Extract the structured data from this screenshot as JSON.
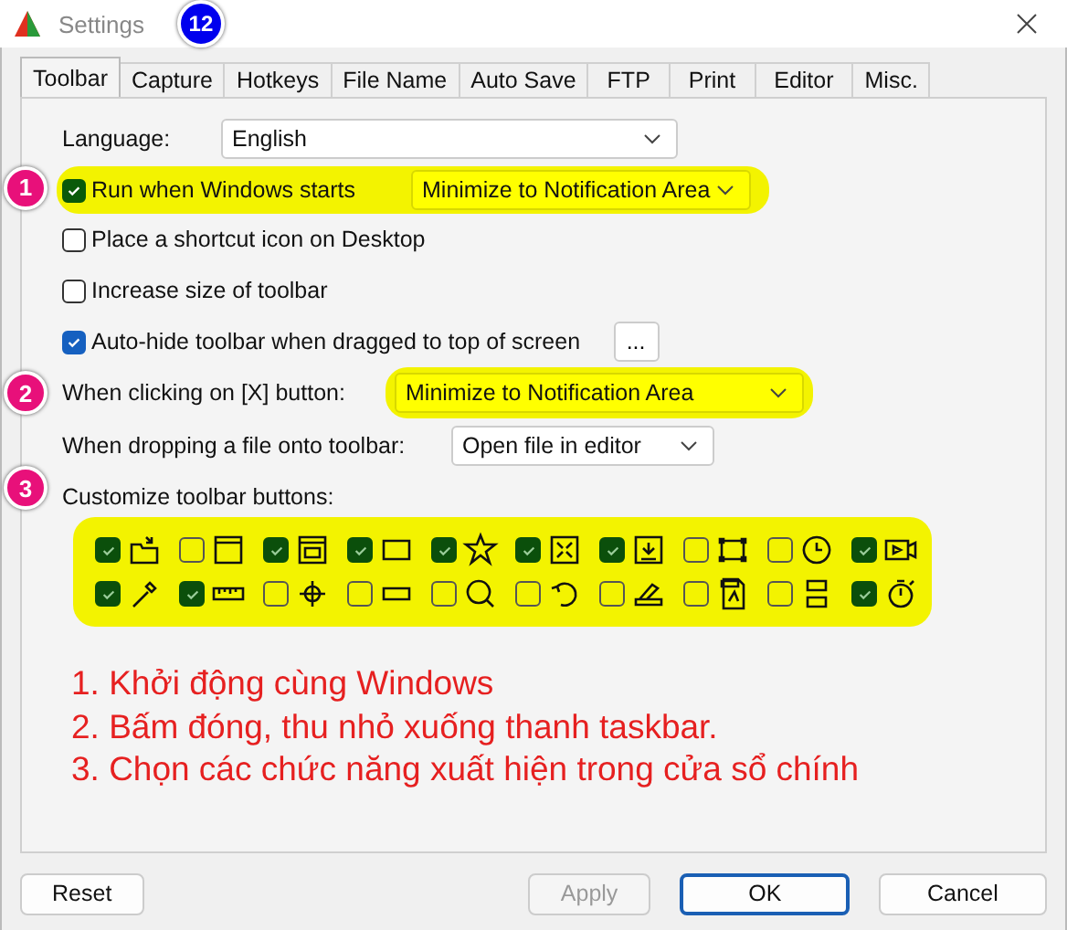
{
  "window": {
    "title": "Settings",
    "badge": "12"
  },
  "tabs": [
    {
      "label": "Toolbar",
      "selected": true
    },
    {
      "label": "Capture",
      "selected": false
    },
    {
      "label": "Hotkeys",
      "selected": false
    },
    {
      "label": "File Name",
      "selected": false
    },
    {
      "label": "Auto Save",
      "selected": false
    },
    {
      "label": "FTP",
      "selected": false
    },
    {
      "label": "Print",
      "selected": false
    },
    {
      "label": "Editor",
      "selected": false
    },
    {
      "label": "Misc.",
      "selected": false
    }
  ],
  "language": {
    "label": "Language:",
    "value": "English"
  },
  "run_at_start": {
    "marker": "1",
    "label": "Run when Windows starts",
    "checked": true,
    "mode": "Minimize to Notification Area",
    "highlighted": true
  },
  "options": [
    {
      "label": "Place a shortcut icon on Desktop",
      "checked": false
    },
    {
      "label": "Increase size of toolbar",
      "checked": false
    },
    {
      "label": "Auto-hide toolbar when dragged to top of screen",
      "checked": true,
      "more_button": "..."
    }
  ],
  "close_action": {
    "marker": "2",
    "label": "When clicking on [X] button:",
    "value": "Minimize to Notification Area",
    "highlighted": true
  },
  "drop_action": {
    "label": "When dropping a file onto toolbar:",
    "value": "Open file in editor"
  },
  "toolbar_buttons": {
    "marker": "3",
    "label": "Customize toolbar buttons:",
    "highlighted": true,
    "items": [
      {
        "checked": true
      },
      {
        "checked": false
      },
      {
        "checked": true
      },
      {
        "checked": true
      },
      {
        "checked": true
      },
      {
        "checked": true
      },
      {
        "checked": true
      },
      {
        "checked": false
      },
      {
        "checked": false
      },
      {
        "checked": true
      },
      {
        "checked": true
      },
      {
        "checked": true
      },
      {
        "checked": false
      },
      {
        "checked": false
      },
      {
        "checked": false
      },
      {
        "checked": false
      },
      {
        "checked": false
      },
      {
        "checked": false
      },
      {
        "checked": false
      },
      {
        "checked": true
      }
    ]
  },
  "annotation_lines": [
    "1. Khởi động cùng Windows",
    "2. Bấm đóng, thu nhỏ xuống thanh taskbar.",
    "3. Chọn các chức năng xuất hiện trong cửa sổ chính"
  ],
  "buttons": [
    {
      "label": "Reset",
      "disabled": false,
      "default": false
    },
    {
      "label": "Apply",
      "disabled": true,
      "default": false
    },
    {
      "label": "OK",
      "disabled": false,
      "default": true
    },
    {
      "label": "Cancel",
      "disabled": false,
      "default": false
    }
  ]
}
